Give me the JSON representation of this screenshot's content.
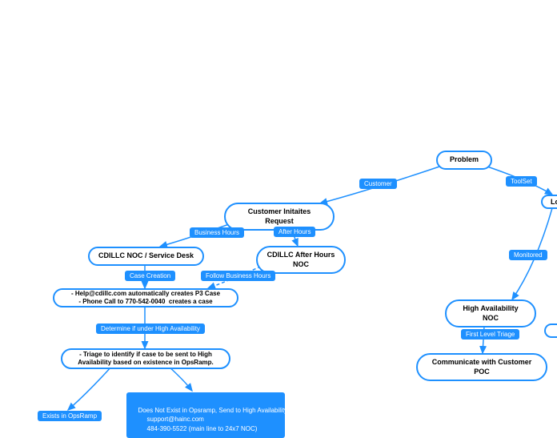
{
  "nodes": {
    "problem": "Problem",
    "customer_init": "Customer Initaites Request",
    "noc_sd": "CDILLC NOC / Service Desk",
    "after_hours_noc": "CDILLC After Hours NOC",
    "case_block_l1": "- Help@cdillc.com automatically creates P3 Case",
    "case_block_l2": "- Phone Call to 770-542-0040  creates a case",
    "triage_l1": "- Triage to identify if case to be sent to High",
    "triage_l2": "Availability based on existence in OpsRamp.",
    "ha_noc": "High Availability NOC",
    "comm_poc": "Communicate with Customer POC",
    "logic": "Logic"
  },
  "labels": {
    "customer": "Customer",
    "toolset": "ToolSet",
    "business_hours": "Business Hours",
    "after_hours": "After Hours",
    "case_creation": "Case Creation",
    "follow_bh": "Follow Business Hours",
    "determine": "Determine if under High Availability",
    "monitored": "Monitored",
    "first_triage": "First Level Triage",
    "exists": "Exists in OpsRamp",
    "send_ha_l1": "Does Not Exist in Opsramp, Send to High Availability",
    "send_ha_l2": "       support@hainc.com",
    "send_ha_l3": "       484-390-5522 (main line to 24x7 NOC)"
  },
  "chart_data": {
    "type": "flowchart",
    "nodes": [
      {
        "id": "problem",
        "label": "Problem"
      },
      {
        "id": "customer_init",
        "label": "Customer Initaites Request"
      },
      {
        "id": "noc_sd",
        "label": "CDILLC NOC / Service Desk"
      },
      {
        "id": "after_hours_noc",
        "label": "CDILLC After Hours NOC"
      },
      {
        "id": "case_block",
        "label": "- Help@cdillc.com automatically creates P3 Case\n- Phone Call to 770-542-0040 creates a case"
      },
      {
        "id": "triage",
        "label": "- Triage to identify if case to be sent to High Availability based on existence in OpsRamp."
      },
      {
        "id": "ha_noc",
        "label": "High Availability NOC"
      },
      {
        "id": "comm_poc",
        "label": "Communicate with Customer POC"
      },
      {
        "id": "logic",
        "label": "Logic (partial)"
      }
    ],
    "edges": [
      {
        "from": "problem",
        "to": "customer_init",
        "label": "Customer"
      },
      {
        "from": "problem",
        "to": "logic",
        "label": "ToolSet"
      },
      {
        "from": "customer_init",
        "to": "noc_sd",
        "label": "Business Hours"
      },
      {
        "from": "customer_init",
        "to": "after_hours_noc",
        "label": "After Hours"
      },
      {
        "from": "noc_sd",
        "to": "case_block",
        "label": "Case Creation"
      },
      {
        "from": "after_hours_noc",
        "to": "case_block",
        "label": "Follow Business Hours",
        "style": "dashed"
      },
      {
        "from": "case_block",
        "to": "triage",
        "label": "Determine if under High Availability"
      },
      {
        "from": "triage",
        "to": "exists_branch",
        "label": "Exists in OpsRamp"
      },
      {
        "from": "triage",
        "to": "ha_send",
        "label": "Does Not Exist in Opsramp, Send to High Availability\nsupport@hainc.com\n484-390-5522 (main line to 24x7 NOC)"
      },
      {
        "from": "logic",
        "to": "ha_noc",
        "label": "Monitored"
      },
      {
        "from": "ha_noc",
        "to": "comm_poc",
        "label": "First Level Triage"
      }
    ]
  }
}
